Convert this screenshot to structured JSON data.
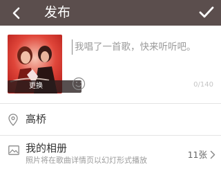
{
  "header": {
    "title": "发布",
    "colors": {
      "bar": "#5b4e4d",
      "icons": "#ffffff"
    }
  },
  "cover": {
    "change_label": "更换",
    "icon": "album-cover-image"
  },
  "caption": {
    "value": "",
    "placeholder": "我唱了一首歌，快来听听吧。",
    "counter": "0/140"
  },
  "location": {
    "label": "高桥",
    "icon": "location-pin-icon"
  },
  "album": {
    "title": "我的相册",
    "subtitle": "照片将在歌曲详情页以幻灯形式播放",
    "count": "11张",
    "icon": "image-icon"
  }
}
